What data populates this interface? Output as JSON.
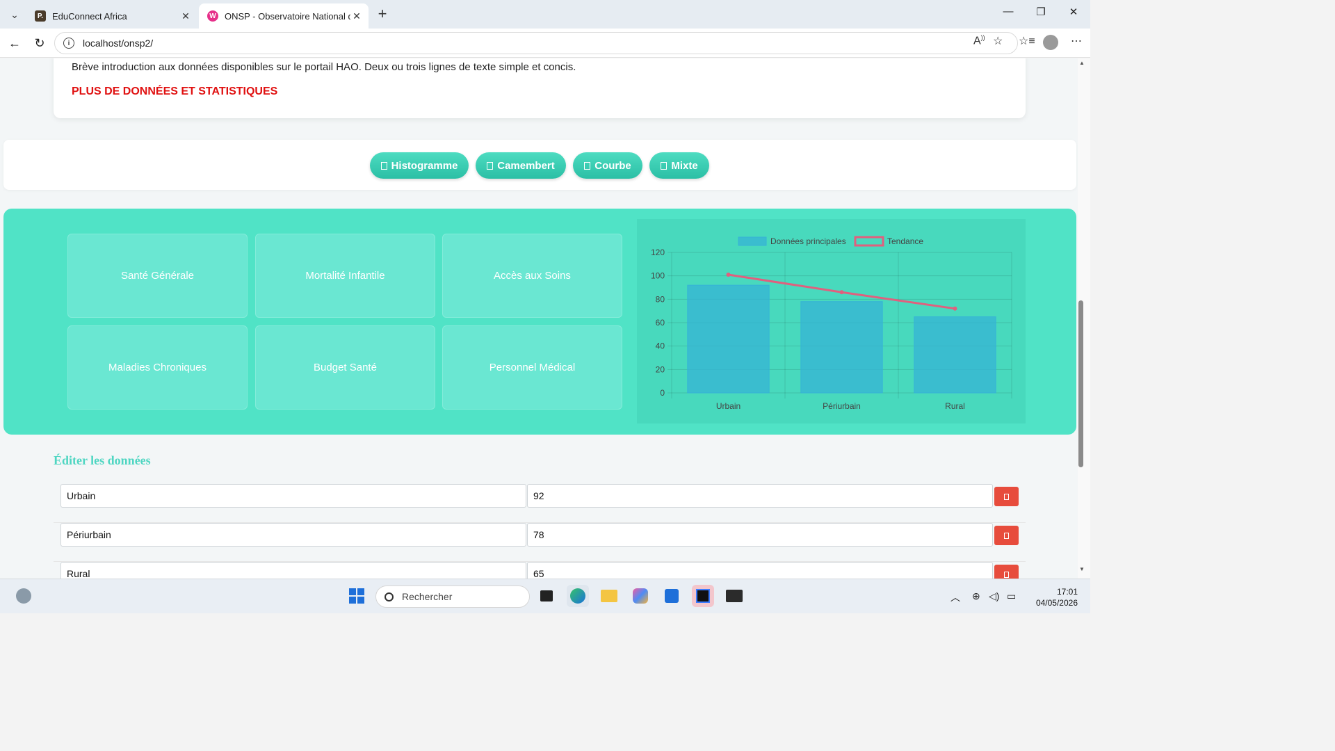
{
  "browser": {
    "tabs": [
      {
        "title": "EduConnect Africa",
        "favicon": "P."
      },
      {
        "title": "ONSP - Observatoire National de l",
        "favicon": "W"
      }
    ],
    "url": "localhost/onsp2/"
  },
  "intro": {
    "text": "Brève introduction aux données disponibles sur le portail HAO. Deux ou trois lignes de texte simple et concis.",
    "link": "PLUS DE DONNÉES ET STATISTIQUES"
  },
  "chart_buttons": [
    "Histogramme",
    "Camembert",
    "Courbe",
    "Mixte"
  ],
  "categories": [
    "Santé Générale",
    "Mortalité Infantile",
    "Accès aux Soins",
    "Maladies Chroniques",
    "Budget Santé",
    "Personnel Médical"
  ],
  "chart_data": {
    "type": "bar",
    "categories": [
      "Urbain",
      "Périurbain",
      "Rural"
    ],
    "series": [
      {
        "name": "Données principales",
        "type": "bar",
        "values": [
          92,
          78,
          65
        ],
        "color": "#36b3d6"
      },
      {
        "name": "Tendance",
        "type": "line",
        "values": [
          101,
          86,
          72
        ],
        "color": "#e0607e"
      }
    ],
    "ylim": [
      0,
      120
    ],
    "yticks": [
      0,
      20,
      40,
      60,
      80,
      100,
      120
    ],
    "legend": "top",
    "grid": true
  },
  "edit": {
    "title": "Éditer les données",
    "rows": [
      {
        "label": "Urbain",
        "value": "92"
      },
      {
        "label": "Périurbain",
        "value": "78"
      },
      {
        "label": "Rural",
        "value": "65"
      }
    ]
  },
  "taskbar": {
    "search_placeholder": "Rechercher",
    "time": "17:01",
    "date": "04/05/2026"
  },
  "colors": {
    "accent": "#50e3c6",
    "link_red": "#e01010",
    "delete_red": "#e74c3c"
  }
}
